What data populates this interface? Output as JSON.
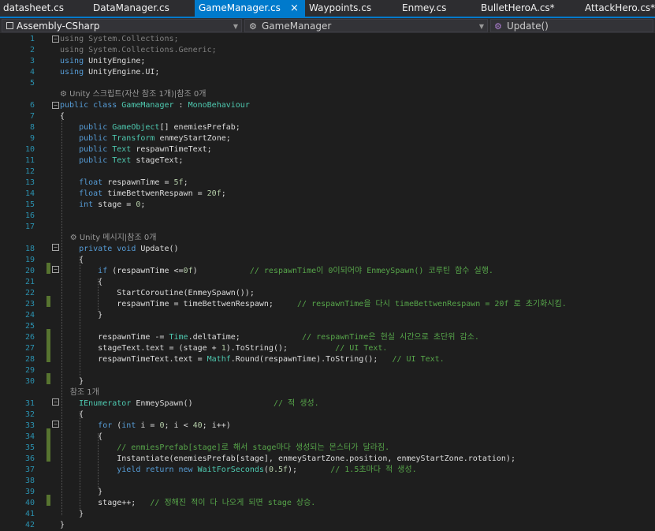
{
  "tabs": [
    {
      "label": "datasheet.cs",
      "active": false
    },
    {
      "label": "DataManager.cs",
      "active": false
    },
    {
      "label": "GameManager.cs",
      "active": true
    },
    {
      "label": "Waypoints.cs",
      "active": false
    },
    {
      "label": "Enmey.cs",
      "active": false
    },
    {
      "label": "BulletHeroA.cs*",
      "active": false
    },
    {
      "label": "AttackHero.cs*",
      "active": false
    }
  ],
  "active_tab_close_icon": "×",
  "nav": {
    "project": "Assembly-CSharp",
    "type": "GameManager",
    "member": "Update()"
  },
  "code_lines": [
    {
      "n": "1",
      "html": "<span class=\"dim\">using System.Collections;</span>"
    },
    {
      "n": "2",
      "html": "<span class=\"dim\">using System.Collections.Generic;</span>"
    },
    {
      "n": "3",
      "html": "<span class=\"k\">using</span> UnityEngine;"
    },
    {
      "n": "4",
      "html": "<span class=\"k\">using</span> UnityEngine.UI;"
    },
    {
      "n": "5",
      "html": ""
    },
    {
      "lens": "⚙ Unity 스크립트(자산 참조 1개)|참조 0개"
    },
    {
      "n": "6",
      "html": "<span class=\"k\">public class</span> <span class=\"t\">GameManager</span> : <span class=\"t\">MonoBehaviour</span>"
    },
    {
      "n": "7",
      "html": "{"
    },
    {
      "n": "8",
      "html": "    <span class=\"k\">public</span> <span class=\"t\">GameObject</span>[] enemiesPrefab;"
    },
    {
      "n": "9",
      "html": "    <span class=\"k\">public</span> <span class=\"t\">Transform</span> enmeyStartZone;"
    },
    {
      "n": "10",
      "html": "    <span class=\"k\">public</span> <span class=\"t\">Text</span> respawnTimeText;"
    },
    {
      "n": "11",
      "html": "    <span class=\"k\">public</span> <span class=\"t\">Text</span> stageText;"
    },
    {
      "n": "12",
      "html": ""
    },
    {
      "n": "13",
      "html": "    <span class=\"k\">float</span> respawnTime = <span class=\"s\">5f</span>;"
    },
    {
      "n": "14",
      "html": "    <span class=\"k\">float</span> timeBettwenRespawn = <span class=\"s\">20f</span>;"
    },
    {
      "n": "15",
      "html": "    <span class=\"k\">int</span> stage = <span class=\"s\">0</span>;"
    },
    {
      "n": "16",
      "html": ""
    },
    {
      "n": "17",
      "html": ""
    },
    {
      "lens": "    ⚙ Unity 메시지|참조 0개"
    },
    {
      "n": "18",
      "html": "    <span class=\"k\">private void</span> Update()"
    },
    {
      "n": "19",
      "html": "    {"
    },
    {
      "n": "20",
      "html": "        <span class=\"k\">if</span> (respawnTime &lt;=<span class=\"s\">0f</span>)           <span class=\"c\">// respawnTime이 0이되어야 EnmeySpawn() 코루틴 함수 실행.</span>"
    },
    {
      "n": "21",
      "html": "        {"
    },
    {
      "n": "22",
      "html": "            StartCoroutine(EnmeySpawn());"
    },
    {
      "n": "23",
      "html": "            respawnTime = timeBettwenRespawn;     <span class=\"c\">// respawnTime을 다시 timeBettwenRespawn = 20f 로 초기화시킴.</span>"
    },
    {
      "n": "24",
      "html": "        }"
    },
    {
      "n": "25",
      "html": ""
    },
    {
      "n": "26",
      "html": "        respawnTime -= <span class=\"t\">Time</span>.deltaTime;             <span class=\"c\">// respawnTime은 현실 시간으로 초단위 감소.</span>"
    },
    {
      "n": "27",
      "html": "        stageText.text = (stage + <span class=\"s\">1</span>).ToString();          <span class=\"c\">// UI Text.</span>"
    },
    {
      "n": "28",
      "html": "        respawnTimeText.text = <span class=\"t\">Mathf</span>.Round(respawnTime).ToString();   <span class=\"c\">// UI Text.</span>"
    },
    {
      "n": "29",
      "html": ""
    },
    {
      "n": "30",
      "html": "    }"
    },
    {
      "lens": "    참조 1개"
    },
    {
      "n": "31",
      "html": "    <span class=\"t\">IEnumerator</span> EnmeySpawn()                 <span class=\"c\">// 적 생성.</span>"
    },
    {
      "n": "32",
      "html": "    {"
    },
    {
      "n": "33",
      "html": "        <span class=\"k\">for</span> (<span class=\"k\">int</span> i = <span class=\"s\">0</span>; i &lt; <span class=\"s\">40</span>; i++)"
    },
    {
      "n": "34",
      "html": "        {"
    },
    {
      "n": "35",
      "html": "            <span class=\"c\">// enmiesPrefab[stage]로 해서 stage마다 생성되는 몬스터가 달라짐.</span>"
    },
    {
      "n": "36",
      "html": "            Instantiate(enemiesPrefab[stage], enmeyStartZone.position, enmeyStartZone.rotation);"
    },
    {
      "n": "37",
      "html": "            <span class=\"k\">yield return new</span> <span class=\"t\">WaitForSeconds</span>(<span class=\"s\">0.5f</span>);       <span class=\"c\">// 1.5초마다 적 생성.</span>"
    },
    {
      "n": "38",
      "html": ""
    },
    {
      "n": "39",
      "html": "        }"
    },
    {
      "n": "40",
      "html": "        stage++;   <span class=\"c\">// 정해진 적이 다 나오게 되면 stage 상승.</span>"
    },
    {
      "n": "41",
      "html": "    }"
    },
    {
      "n": "42",
      "html": "}"
    }
  ]
}
